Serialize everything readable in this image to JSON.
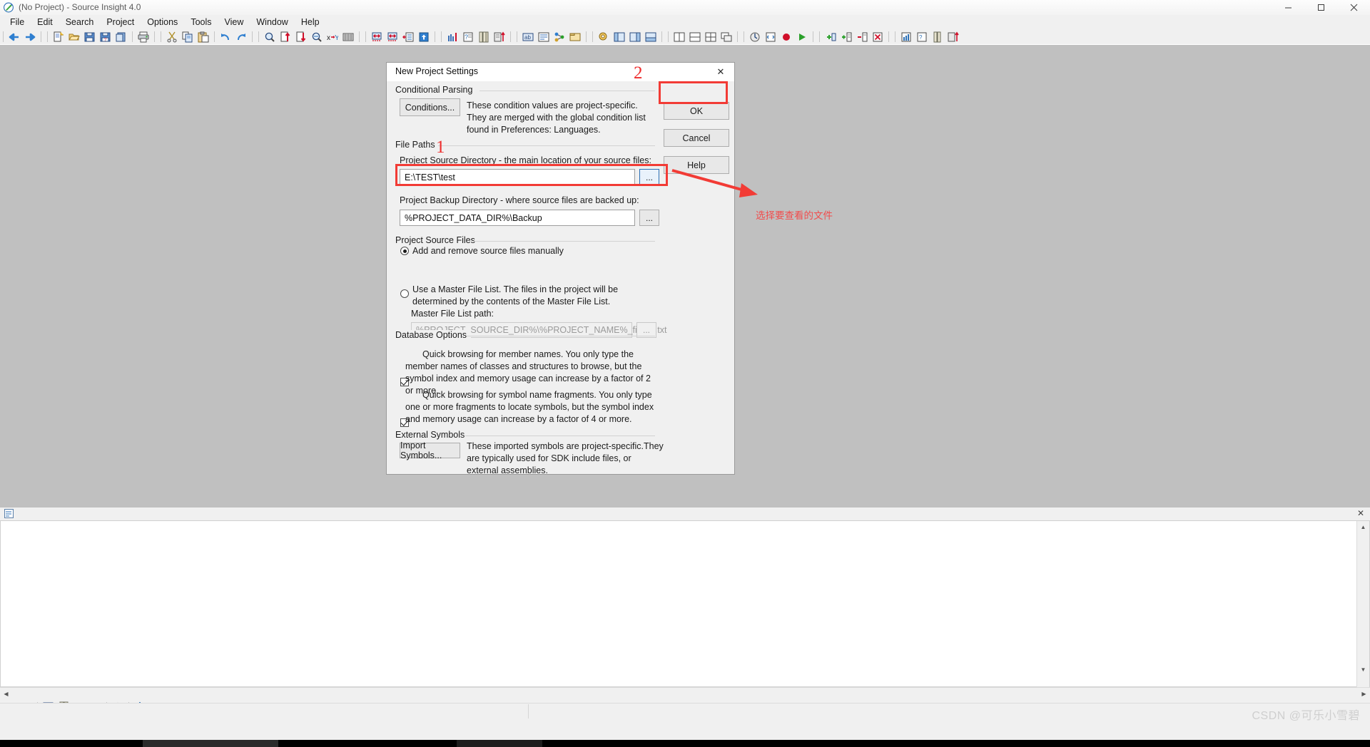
{
  "window": {
    "title": "(No Project) - Source Insight 4.0",
    "app_icon": "source-insight-icon",
    "minimize": "—",
    "maximize": "▢",
    "close": "✕"
  },
  "menubar": {
    "items": [
      "File",
      "Edit",
      "Search",
      "Project",
      "Options",
      "Tools",
      "View",
      "Window",
      "Help"
    ]
  },
  "toolbar": {
    "groups": [
      [
        "nav-back-icon",
        "nav-forward-icon"
      ],
      [
        "new-file-icon",
        "open-file-icon",
        "save-icon",
        "save-all-icon",
        "close-file-icon"
      ],
      [
        "print-icon"
      ],
      [
        "cut-icon",
        "copy-icon",
        "paste-icon"
      ],
      [
        "undo-icon",
        "redo-icon"
      ],
      [
        "search-icon",
        "search-backward-icon",
        "search-forward-icon",
        "search-files-icon",
        "replace-icon",
        "search-project-icon"
      ],
      [
        "jump-back-icon",
        "jump-forward-icon",
        "symbol-window-icon",
        "context-window-icon"
      ],
      [
        "bookmark-icon",
        "relation-window-icon",
        "file-list-icon",
        "browse-icon"
      ],
      [
        "smart-rename-icon",
        "reference-icon",
        "callers-icon",
        "project-icon"
      ],
      [
        "outline-icon",
        "expand-icon",
        "collapse-icon",
        "sync-icon"
      ],
      [
        "profile-icon",
        "analyze-icon",
        "rebuild-icon",
        "lang-icon"
      ],
      [
        "grid-1-icon",
        "grid-2-icon",
        "grid-3-icon",
        "grid-4-icon"
      ],
      [
        "zoom-icon",
        "panel-left-icon",
        "panel-right-icon",
        "panel-bottom-icon"
      ],
      [
        "horiz-split-icon",
        "vert-split-icon",
        "tile-icon",
        "cascade-icon"
      ],
      [
        "calc-icon",
        "script-icon",
        "record-icon",
        "play-icon"
      ],
      [
        "add-item-icon",
        "add-tree-icon",
        "remove-tree-icon",
        "delete-icon"
      ],
      [
        "win-a-icon",
        "win-b-icon",
        "win-c-icon",
        "win-d-icon"
      ]
    ]
  },
  "dialog": {
    "title": "New Project Settings",
    "close_glyph": "✕",
    "buttons": {
      "ok": "OK",
      "cancel": "Cancel",
      "help": "Help"
    },
    "conditional_parsing": {
      "group_label": "Conditional Parsing",
      "button": "Conditions...",
      "description": "These condition values are project-specific.  They are merged with the global condition list found in Preferences: Languages."
    },
    "file_paths": {
      "group_label": "File Paths",
      "source_dir_label": "Project Source Directory - the main location of your source files:",
      "source_dir_value": "E:\\TEST\\test",
      "source_dir_browse": "...",
      "backup_dir_label": "Project Backup Directory - where source files are backed up:",
      "backup_dir_value": "%PROJECT_DATA_DIR%\\Backup",
      "backup_dir_browse": "..."
    },
    "project_source_files": {
      "group_label": "Project Source Files",
      "option_manual": "Add and remove source files manually",
      "option_masterlist": "Use a Master File List. The files in the project will be determined by the contents of the Master File List.",
      "selected": "manual",
      "master_path_label": "Master File List path:",
      "master_path_value": "%PROJECT_SOURCE_DIR%\\%PROJECT_NAME%_filelist.txt",
      "master_path_browse": "..."
    },
    "database_options": {
      "group_label": "Database Options",
      "option1": "Quick browsing for member names.  You only type the member names of classes and structures to browse, but the symbol index and memory usage can increase by a factor of 2 or more.",
      "option1_checked": true,
      "option2": "Quick browsing for symbol name fragments.  You only type one or more fragments to locate symbols, but the symbol index and memory usage can increase by a factor of 4 or more.",
      "option2_checked": true
    },
    "external_symbols": {
      "group_label": "External Symbols",
      "button": "Import Symbols...",
      "description": "These imported symbols are project-specific.They are typically used for SDK include files, or external assemblies."
    }
  },
  "annotations": {
    "marker_one": "1",
    "marker_two": "2",
    "note_text": "选择要查看的文件",
    "highlight_color": "#f23b35",
    "note_color": "#f14c4c"
  },
  "statusbar": {
    "watermark": "CSDN @可乐小雪碧"
  }
}
